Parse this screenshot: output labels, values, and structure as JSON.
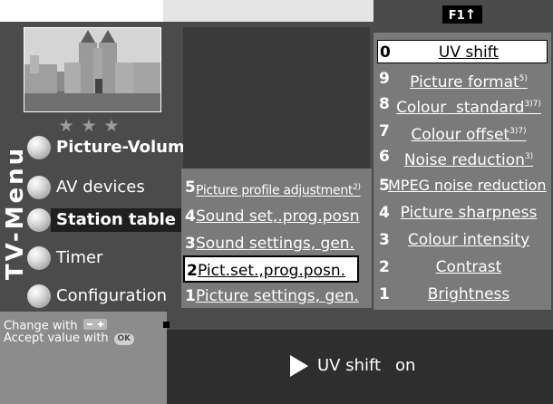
{
  "header": {
    "function_key_label": "F1",
    "function_key_arrow": "↑"
  },
  "sidebar": {
    "vertical_title": "TV-Menu",
    "rating_stars": "★★★",
    "items": [
      {
        "label": "Picture-Volume",
        "icon": "ball-icon"
      },
      {
        "label": "AV devices",
        "icon": "ball-icon"
      },
      {
        "label": "Station table",
        "icon": "ball-icon"
      },
      {
        "label": "Timer",
        "icon": "ball-icon"
      },
      {
        "label": "Configuration",
        "icon": "ball-icon"
      }
    ]
  },
  "submenu": {
    "items": [
      {
        "num": "5",
        "label": "Picture profile adjustment",
        "sup": "2)"
      },
      {
        "num": "4",
        "label": "Sound set,.prog.posn",
        "sup": ""
      },
      {
        "num": "3",
        "label": "Sound settings, gen.",
        "sup": ""
      },
      {
        "num": "2",
        "label": "Pict.set.,prog.posn.",
        "sup": ""
      },
      {
        "num": "1",
        "label": "Picture settings, gen.",
        "sup": ""
      }
    ]
  },
  "options": {
    "items": [
      {
        "num": "0",
        "label": "UV shift",
        "sup": ""
      },
      {
        "num": "9",
        "label": "Picture format",
        "sup": "5)"
      },
      {
        "num": "8",
        "label": "Colour  standard",
        "sup": "3)7)"
      },
      {
        "num": "7",
        "label": "Colour offset",
        "sup": "3)7)"
      },
      {
        "num": "6",
        "label": "Noise reduction",
        "sup": "3)"
      },
      {
        "num": "5",
        "label": "MPEG noise reduction",
        "sup": ""
      },
      {
        "num": "4",
        "label": "Picture sharpness",
        "sup": ""
      },
      {
        "num": "3",
        "label": "Colour intensity",
        "sup": ""
      },
      {
        "num": "2",
        "label": "Contrast",
        "sup": ""
      },
      {
        "num": "1",
        "label": "Brightness",
        "sup": ""
      }
    ]
  },
  "help": {
    "change_text": "Change with",
    "change_key_icon": "minus-plus-key-icon",
    "accept_text": "Accept value with",
    "accept_key": "OK"
  },
  "status": {
    "arrow_icon": "play-arrow-icon",
    "setting_name": "UV shift",
    "setting_value": "on"
  },
  "colors": {
    "background": "#4b4b4b",
    "panel": "#7a7a7a",
    "selected": "#ffffff",
    "status_bar": "#2e2e2e",
    "help_panel": "#8c8c8c"
  }
}
